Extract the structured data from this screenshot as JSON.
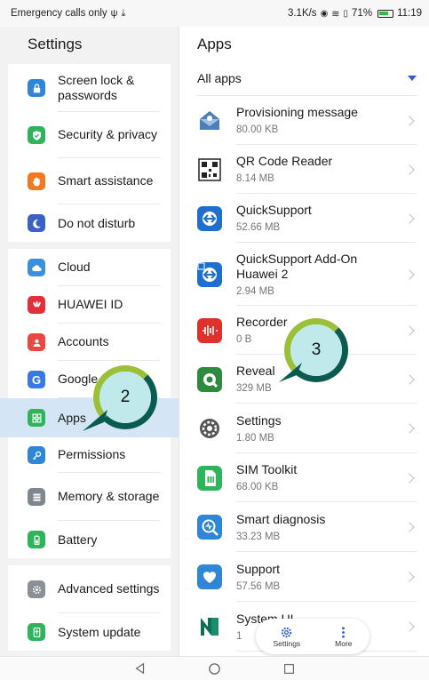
{
  "status_bar": {
    "left_text": "Emergency calls only",
    "speed": "3.1K/s",
    "battery": "71%",
    "time": "11:19"
  },
  "left_pane": {
    "title": "Settings",
    "groups": [
      [
        {
          "label": "Screen lock & passwords",
          "icon": "lock-icon",
          "color": "#2f86d6"
        },
        {
          "label": "Security & privacy",
          "icon": "shield-check-icon",
          "color": "#2eb45a"
        },
        {
          "label": "Smart assistance",
          "icon": "hand-icon",
          "color": "#f07a22"
        },
        {
          "label": "Do not disturb",
          "icon": "moon-icon",
          "color": "#3d5fc8"
        }
      ],
      [
        {
          "label": "Cloud",
          "icon": "cloud-icon",
          "color": "#3a8fe0"
        },
        {
          "label": "HUAWEI ID",
          "icon": "huawei-logo-icon",
          "color": "#e0303a"
        },
        {
          "label": "Accounts",
          "icon": "account-icon",
          "color": "#e9473f"
        },
        {
          "label": "Google",
          "icon": "google-icon",
          "color": "#3b78e7"
        },
        {
          "label": "Apps",
          "icon": "apps-grid-icon",
          "color": "#2eb45a",
          "selected": true
        },
        {
          "label": "Permissions",
          "icon": "key-icon",
          "color": "#2f86d6"
        },
        {
          "label": "Memory & storage",
          "icon": "storage-icon",
          "color": "#7d8790"
        },
        {
          "label": "Battery",
          "icon": "battery-icon",
          "color": "#2eb45a"
        }
      ],
      [
        {
          "label": "Advanced settings",
          "icon": "gear-icon",
          "color": "#8a9096"
        },
        {
          "label": "System update",
          "icon": "system-update-icon",
          "color": "#2eb45a"
        }
      ]
    ]
  },
  "right_pane": {
    "title": "Apps",
    "filter": "All apps",
    "apps": [
      {
        "name": "Provisioning message",
        "size": "80.00 KB",
        "icon": "provisioning-icon"
      },
      {
        "name": "QR Code Reader",
        "size": "8.14 MB",
        "icon": "qr-code-icon"
      },
      {
        "name": "QuickSupport",
        "size": "52.66 MB",
        "icon": "quicksupport-icon"
      },
      {
        "name": "QuickSupport Add-On Huawei 2",
        "size": "2.94 MB",
        "icon": "quicksupport-addon-icon"
      },
      {
        "name": "Recorder",
        "size": "0 B",
        "icon": "recorder-icon"
      },
      {
        "name": "Reveal",
        "size": "329 MB",
        "icon": "reveal-icon"
      },
      {
        "name": "Settings",
        "size": "1.80 MB",
        "icon": "settings-app-icon"
      },
      {
        "name": "SIM Toolkit",
        "size": "68.00 KB",
        "icon": "sim-toolkit-icon"
      },
      {
        "name": "Smart diagnosis",
        "size": "33.23 MB",
        "icon": "smart-diagnosis-icon"
      },
      {
        "name": "Support",
        "size": "57.56 MB",
        "icon": "support-icon"
      },
      {
        "name": "System UI",
        "size": "1",
        "icon": "system-ui-icon"
      }
    ]
  },
  "floating_bar": {
    "settings_label": "Settings",
    "more_label": "More"
  },
  "callouts": {
    "step_a": "2",
    "step_b": "3"
  }
}
